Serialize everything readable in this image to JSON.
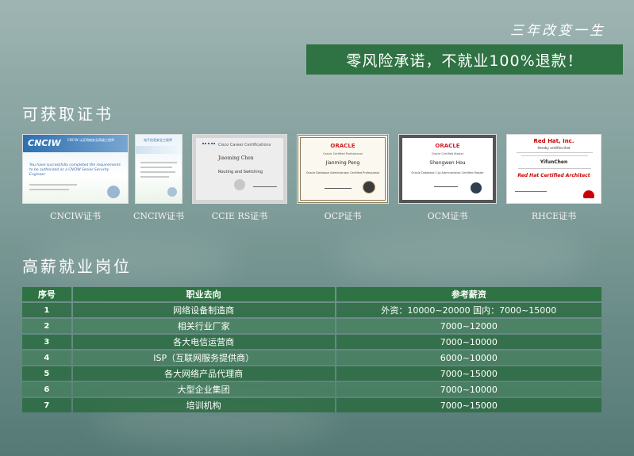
{
  "header": {
    "slogan": "三年改变一生",
    "banner": "零风险承诺，不就业100%退款！"
  },
  "certificates": {
    "title": "可获取证书",
    "items": [
      {
        "caption": "CNCIW证书",
        "logo": "CNCIW",
        "heading": "CNCIW 认证网络安全高级工程师",
        "text": "You have successfully completed the requirements to be authorized as a CNCIW Senior Security Engineer"
      },
      {
        "caption": "CNCIW证书",
        "logo": "",
        "heading": "电子信息安全工程师",
        "text": ""
      },
      {
        "caption": "CCIE RS证书",
        "logo": "",
        "heading": "Cisco Career Certifications",
        "name": "Jiaoming Chen",
        "text": "Routing and Switching"
      },
      {
        "caption": "OCP证书",
        "logo": "ORACLE",
        "heading": "Oracle Certified Professional",
        "name": "Jianming Peng",
        "text": "Oracle Database Administrator Certified Professional"
      },
      {
        "caption": "OCM证书",
        "logo": "ORACLE",
        "heading": "Oracle Certified Master",
        "name": "Shengwen Hou",
        "text": "Oracle Database 11g Administrator Certified Master"
      },
      {
        "caption": "RHCE证书",
        "logo": "Red Hat, Inc.",
        "heading": "Hereby certifies that",
        "name": "YifunChen",
        "text": "Red Hat Certified Architect"
      }
    ]
  },
  "jobs": {
    "title": "高薪就业岗位",
    "headers": {
      "no": "序号",
      "position": "职业去向",
      "salary": "参考薪资"
    },
    "rows": [
      {
        "no": "1",
        "position": "网络设备制造商",
        "salary": "外资：10000~20000  国内：7000~15000"
      },
      {
        "no": "2",
        "position": "相关行业厂家",
        "salary": "7000~12000"
      },
      {
        "no": "3",
        "position": "各大电信运营商",
        "salary": "7000~10000"
      },
      {
        "no": "4",
        "position": "ISP（互联网服务提供商）",
        "salary": "6000~10000"
      },
      {
        "no": "5",
        "position": "各大网络产品代理商",
        "salary": "7000~15000"
      },
      {
        "no": "6",
        "position": "大型企业集团",
        "salary": "7000~10000"
      },
      {
        "no": "7",
        "position": "培训机构",
        "salary": "7000~15000"
      }
    ]
  },
  "colors": {
    "accent": "#2f7243",
    "text": "#ffffff"
  }
}
